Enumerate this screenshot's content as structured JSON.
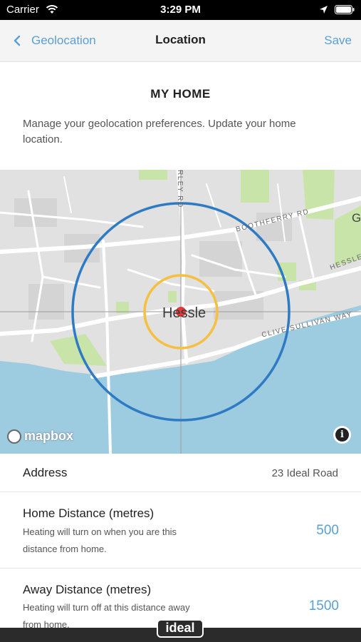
{
  "status_bar": {
    "carrier": "Carrier",
    "time": "3:29 PM"
  },
  "nav": {
    "back_label": "Geolocation",
    "title": "Location",
    "save_label": "Save"
  },
  "header": {
    "title": "MY HOME",
    "description": "Manage your geolocation preferences. Update your home location."
  },
  "map": {
    "town": "Hessle",
    "road_labels": [
      "RLEY RD",
      "BOOTHFERRY RD",
      "HESSLE R",
      "CLIVE SULLIVAN WAY",
      "G"
    ],
    "attribution": "mapbox",
    "info_symbol": "i",
    "home_radius_color": "#f5c040",
    "away_radius_color": "#2e7bc4",
    "marker_color": "#e03a3a"
  },
  "address": {
    "label": "Address",
    "value": "23 Ideal Road"
  },
  "home_distance": {
    "label": "Home Distance (metres)",
    "description": "Heating will turn on when you are this distance from home.",
    "value": "500"
  },
  "away_distance": {
    "label": "Away Distance (metres)",
    "description": "Heating will turn off at this distance away from home.",
    "value": "1500"
  },
  "brand": {
    "logo_text": "ideal"
  }
}
